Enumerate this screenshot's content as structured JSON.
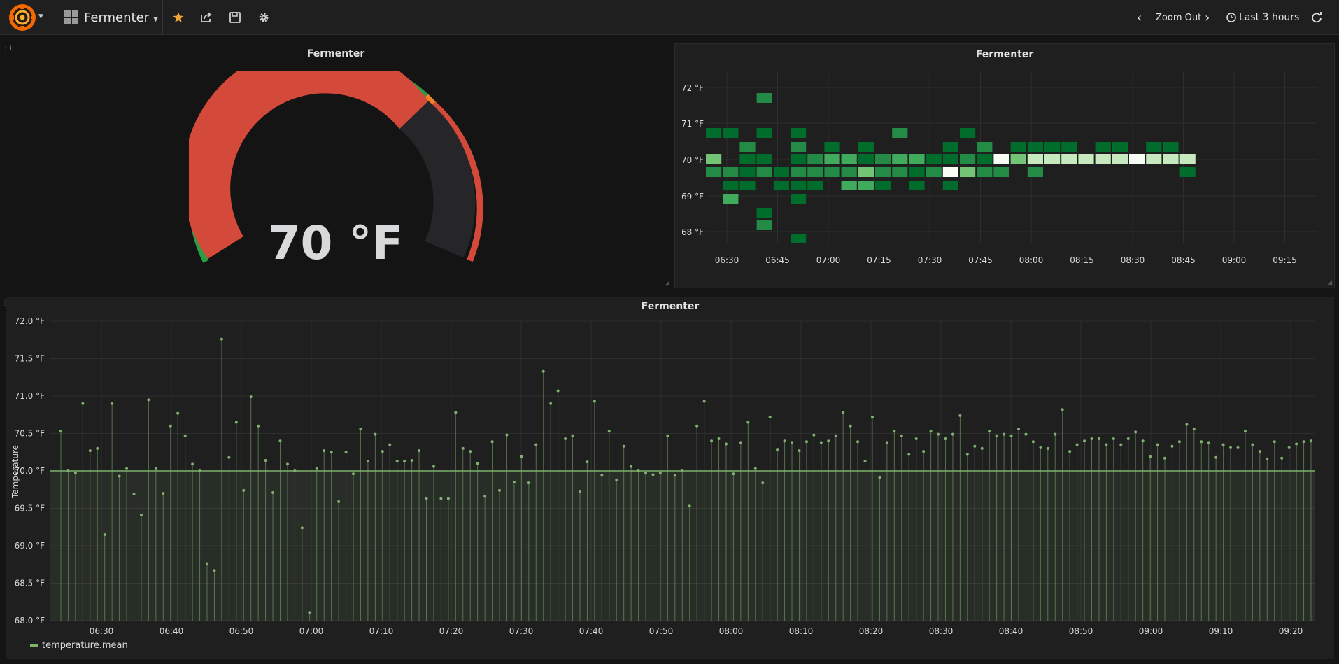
{
  "navbar": {
    "dashboard_title": "Fermenter",
    "zoom_out_label": "Zoom Out",
    "time_range_label": "Last 3 hours"
  },
  "colors": {
    "gauge_red": "#d44a3a",
    "gauge_green": "#299c46",
    "gauge_orange": "#ed8128",
    "series_green": "#7eb26d",
    "star": "#f2a33a"
  },
  "gauge_panel": {
    "title": "Fermenter",
    "value": 70,
    "value_text": "70 °F"
  },
  "heatmap_panel": {
    "title": "Fermenter",
    "y_labels": [
      "72 °F",
      "71 °F",
      "70 °F",
      "69 °F",
      "68 °F"
    ],
    "x_labels": [
      "06:30",
      "06:45",
      "07:00",
      "07:15",
      "07:30",
      "07:45",
      "08:00",
      "08:15",
      "08:30",
      "08:45",
      "09:00",
      "09:15"
    ]
  },
  "graph_panel": {
    "title": "Fermenter",
    "y_axis_label": "Temperature",
    "y_labels": [
      "72.0 °F",
      "71.5 °F",
      "71.0 °F",
      "70.5 °F",
      "70.0 °F",
      "69.5 °F",
      "69.0 °F",
      "68.5 °F",
      "68.0 °F"
    ],
    "x_labels": [
      "06:30",
      "06:40",
      "06:50",
      "07:00",
      "07:10",
      "07:20",
      "07:30",
      "07:40",
      "07:50",
      "08:00",
      "08:10",
      "08:20",
      "08:30",
      "08:40",
      "08:50",
      "09:00",
      "09:10",
      "09:20"
    ],
    "legend_series": "temperature.mean"
  }
}
